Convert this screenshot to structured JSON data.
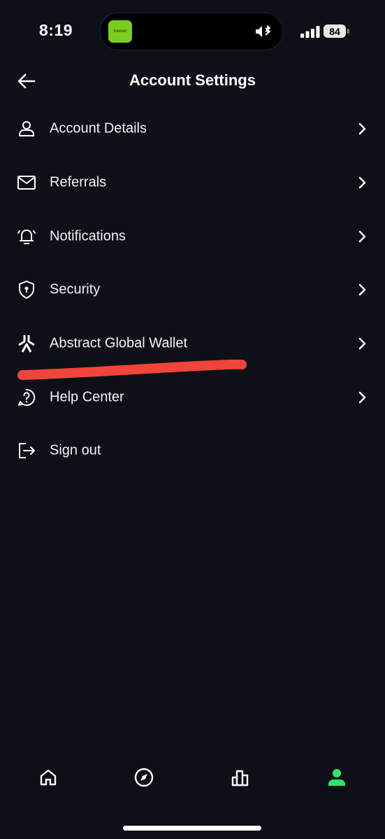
{
  "status_bar": {
    "time": "8:19",
    "island_app_label": "forever",
    "battery_level": "84"
  },
  "header": {
    "title": "Account Settings"
  },
  "menu": {
    "items": [
      {
        "label": "Account Details",
        "icon": "person-icon"
      },
      {
        "label": "Referrals",
        "icon": "mail-icon"
      },
      {
        "label": "Notifications",
        "icon": "bell-icon"
      },
      {
        "label": "Security",
        "icon": "shield-icon"
      },
      {
        "label": "Abstract Global Wallet",
        "icon": "abstract-logo-icon"
      },
      {
        "label": "Help Center",
        "icon": "help-icon"
      },
      {
        "label": "Sign out",
        "icon": "sign-out-icon"
      }
    ]
  },
  "tab_bar": {
    "tabs": [
      {
        "icon": "home-icon",
        "active": false
      },
      {
        "icon": "compass-icon",
        "active": false
      },
      {
        "icon": "leaderboard-icon",
        "active": false
      },
      {
        "icon": "profile-icon",
        "active": true
      }
    ]
  },
  "colors": {
    "background": "#0d1117",
    "text": "#ffffff",
    "accent_active": "#2ee66b",
    "highlight_stroke": "#f0453a",
    "island_app": "#7ccd1e"
  }
}
